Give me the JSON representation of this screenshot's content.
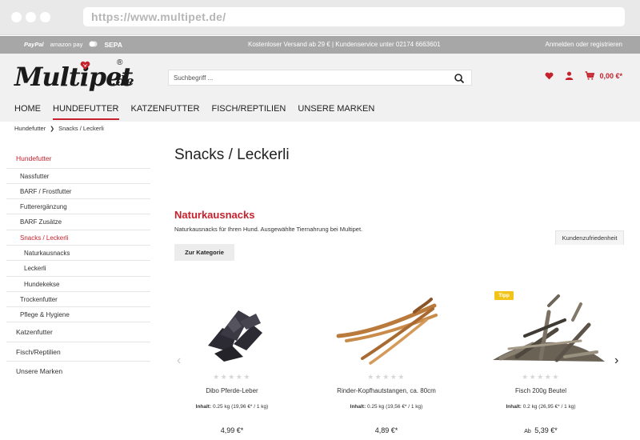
{
  "browser": {
    "url": "https://www.multipet.de/"
  },
  "topbar": {
    "payment": [
      "PayPal",
      "amazon pay",
      "SEPA"
    ],
    "info": "Kostenloser Versand ab 29 € | Kundenservice unter 02174 6663601",
    "account_link": "Anmelden oder registrieren"
  },
  "header": {
    "logo_text": "Multipet",
    "logo_suffix": ".de",
    "logo_reg": "®",
    "search_placeholder": "Suchbegriff ...",
    "cart_total": "0,00 €*",
    "accent_color": "#c5222d"
  },
  "nav": {
    "items": [
      "HOME",
      "HUNDEFUTTER",
      "KATZENFUTTER",
      "FISCH/REPTILIEN",
      "UNSERE MARKEN"
    ],
    "active": "HUNDEFUTTER"
  },
  "breadcrumb": [
    "Hundefutter",
    "Snacks / Leckerli"
  ],
  "sidebar": {
    "items": [
      {
        "label": "Hundefutter",
        "level": 0,
        "active": true
      },
      {
        "label": "Nassfutter",
        "level": 1
      },
      {
        "label": "BARF / Frostfutter",
        "level": 1
      },
      {
        "label": "Futterergänzung",
        "level": 1
      },
      {
        "label": "BARF Zusätze",
        "level": 1
      },
      {
        "label": "Snacks / Leckerli",
        "level": 1,
        "active": true
      },
      {
        "label": "Naturkausnacks",
        "level": 2
      },
      {
        "label": "Leckerli",
        "level": 2
      },
      {
        "label": "Hundekekse",
        "level": 2
      },
      {
        "label": "Trockenfutter",
        "level": 1
      },
      {
        "label": "Pflege & Hygiene",
        "level": 1
      },
      {
        "label": "Katzenfutter",
        "level": 0
      },
      {
        "label": "Fisch/Reptilien",
        "level": 0
      },
      {
        "label": "Unsere Marken",
        "level": 0
      }
    ]
  },
  "main": {
    "page_title": "Snacks / Leckerli",
    "category_title": "Naturkausnacks",
    "category_description": "Naturkausnacks für Ihren Hund. Ausgewählte Tiernahrung bei Multipet.",
    "category_button": "Zur Kategorie",
    "rating_tab": "Kundenzufriedenheit"
  },
  "products": [
    {
      "name": "Dibo Pferde-Leber",
      "info_label": "Inhalt:",
      "info_value": "0.25 kg (19,96 €* / 1 kg)",
      "price_prefix": "",
      "price": "4,99 €*",
      "badge": "",
      "rating": 0,
      "image": "dark-liver-chunks"
    },
    {
      "name": "Rinder-Kopfhautstangen, ca. 80cm",
      "info_label": "Inhalt:",
      "info_value": "0.25 kg (19,56 €* / 1 kg)",
      "price_prefix": "",
      "price": "4,89 €*",
      "badge": "",
      "rating": 0,
      "image": "long-beef-sticks"
    },
    {
      "name": "Fisch 200g Beutel",
      "info_label": "Inhalt:",
      "info_value": "0.2 kg (26,95 €* / 1 kg)",
      "price_prefix": "Ab",
      "price": "5,39 €*",
      "badge": "Tipp",
      "rating": 0,
      "image": "dried-fish-pile"
    }
  ]
}
